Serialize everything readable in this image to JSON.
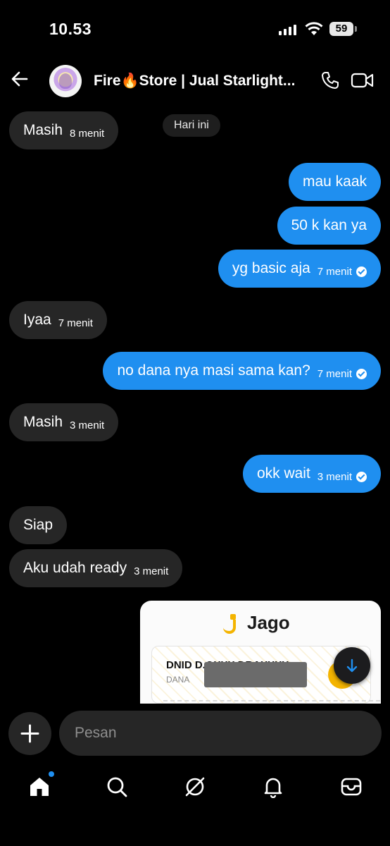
{
  "status_bar": {
    "time": "10.53",
    "battery": "59"
  },
  "header": {
    "title": "Fire🔥Store | Jual Starlight..."
  },
  "day_divider": "Hari ini",
  "messages": [
    {
      "text": "Masih",
      "time": "8 menit"
    },
    {
      "text": "mau kaak"
    },
    {
      "text": "50 k kan ya"
    },
    {
      "text": "yg basic aja",
      "time": "7 menit"
    },
    {
      "text": "Iyaa",
      "time": "7 menit"
    },
    {
      "text": "no dana nya masi sama kan?",
      "time": "7 menit"
    },
    {
      "text": "Masih",
      "time": "3 menit"
    },
    {
      "text": "okk wait",
      "time": "3 menit"
    },
    {
      "text": "Siap"
    },
    {
      "text": "Aku udah ready",
      "time": "3 menit"
    }
  ],
  "receipt": {
    "brand": "Jago",
    "account_name": "DNID D.OXXX DRAXXXX",
    "bank": "DANA"
  },
  "composer": {
    "placeholder": "Pesan"
  },
  "colors": {
    "outgoing": "#1f8ff0",
    "incoming": "#262626",
    "background": "#000000",
    "accent": "#f4b400"
  },
  "icons": [
    "back-arrow-icon",
    "phone-icon",
    "video-icon",
    "plus-icon",
    "home-icon",
    "search-icon",
    "explore-icon",
    "bell-icon",
    "inbox-icon",
    "arrow-down-icon"
  ]
}
